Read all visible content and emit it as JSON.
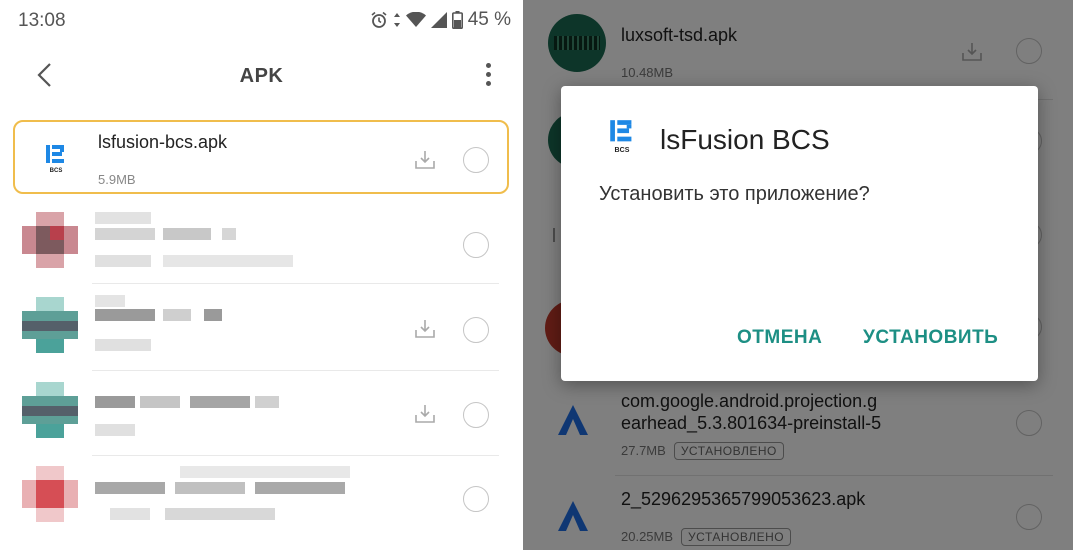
{
  "status_bar": {
    "time": "13:08",
    "battery_percent": "45 %"
  },
  "app_bar": {
    "title": "APK"
  },
  "file_list": [
    {
      "name": "lsfusion-bcs.apk",
      "size": "5.9MB",
      "icon_label": "BCS"
    }
  ],
  "background_list": [
    {
      "name": "luxsoft-tsd.apk",
      "size": "10.48MB"
    },
    {
      "name": "com.google.android.projection.g",
      "name_line2": "earhead_5.3.801634-preinstall-5",
      "size": "27.7MB",
      "badge": "УСТАНОВЛЕНО"
    },
    {
      "name": "2_5296295365799053623.apk",
      "size": "20.25MB",
      "badge": "УСТАНОВЛЕНО"
    }
  ],
  "dialog": {
    "title": "lsFusion BCS",
    "icon_label": "BCS",
    "message": "Установить это приложение?",
    "cancel_label": "ОТМЕНА",
    "install_label": "УСТАНОВИТЬ"
  },
  "colors": {
    "highlight": "#f0bd4c",
    "accent": "#1d8f84"
  }
}
